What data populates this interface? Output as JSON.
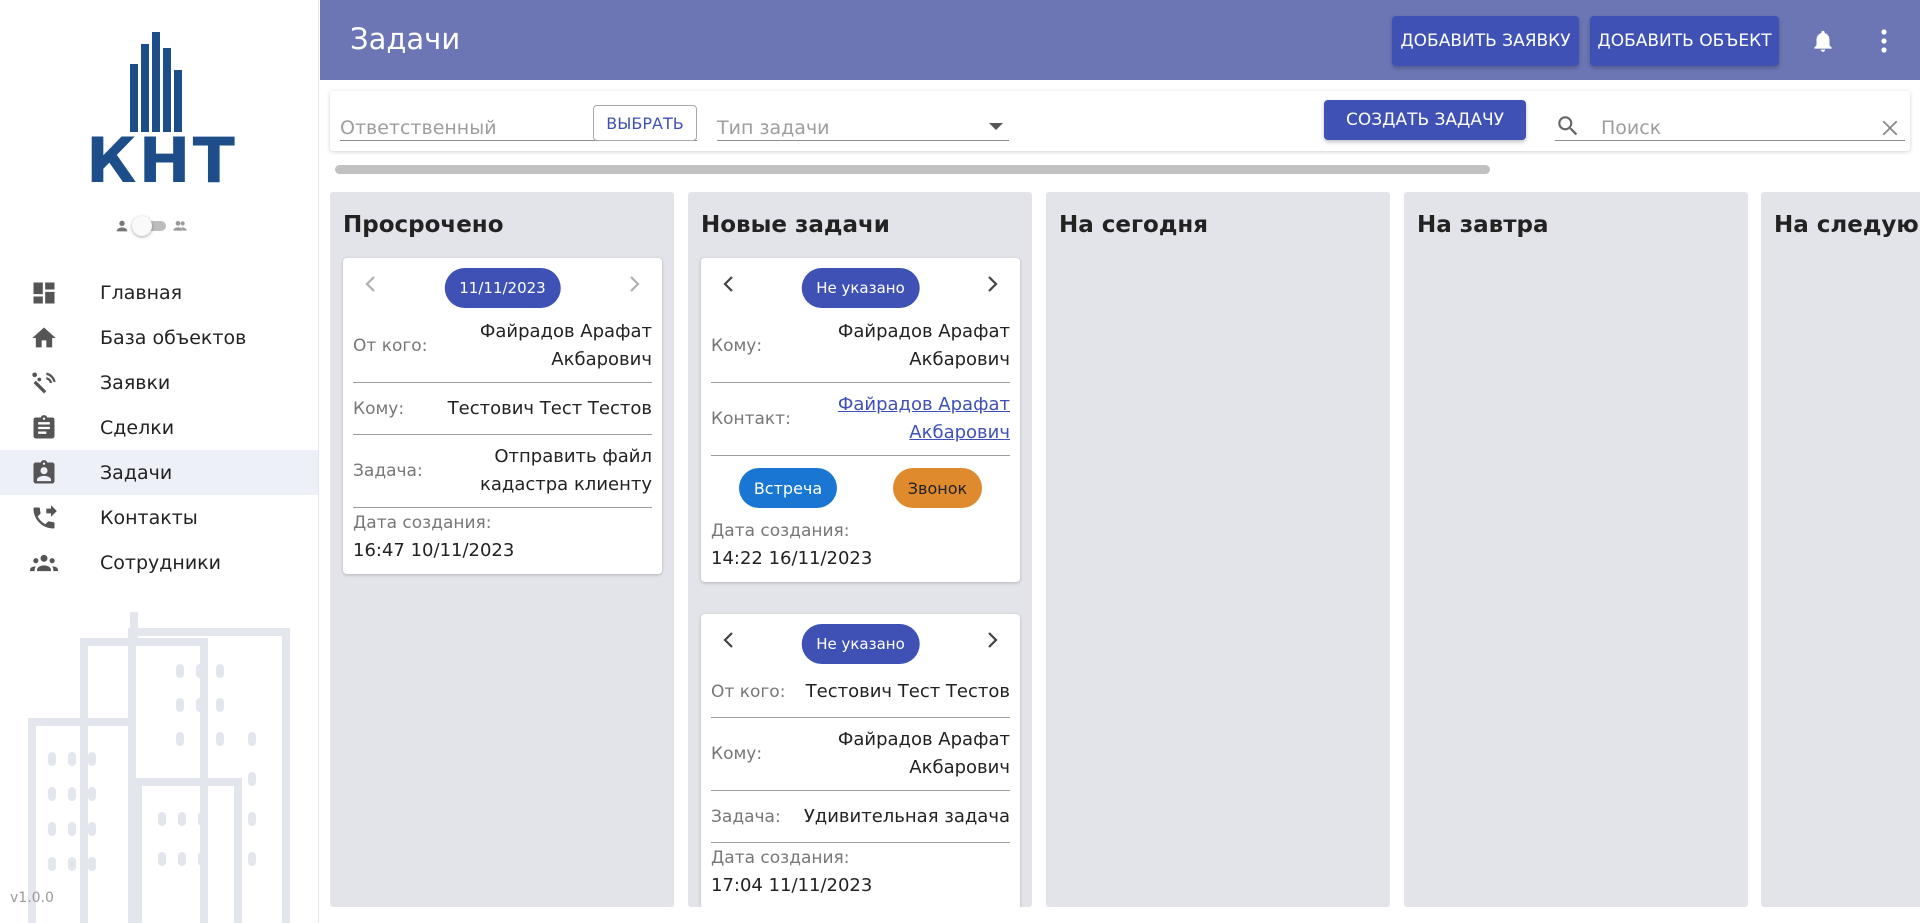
{
  "app": {
    "logo_text": "КНТ",
    "version": "v1.0.0"
  },
  "sidebar": {
    "items": [
      {
        "label": "Главная",
        "icon": "dashboard-icon"
      },
      {
        "label": "База объектов",
        "icon": "home-icon"
      },
      {
        "label": "Заявки",
        "icon": "signal-icon"
      },
      {
        "label": "Сделки",
        "icon": "clipboard-icon"
      },
      {
        "label": "Задачи",
        "icon": "assignment-ind-icon",
        "active": true
      },
      {
        "label": "Контакты",
        "icon": "phone-forwarded-icon"
      },
      {
        "label": "Сотрудники",
        "icon": "group-icon"
      }
    ]
  },
  "header": {
    "title": "Задачи",
    "add_request_label": "ДОБАВИТЬ ЗАЯВКУ",
    "add_object_label": "ДОБАВИТЬ ОБЪЕКТ"
  },
  "filters": {
    "responsible_placeholder": "Ответственный",
    "select_label": "ВЫБРАТЬ",
    "task_type_placeholder": "Тип задачи",
    "create_task_label": "СОЗДАТЬ ЗАДАЧУ",
    "search_placeholder": "Поиск"
  },
  "columns": [
    {
      "title": "Просрочено"
    },
    {
      "title": "Новые задачи"
    },
    {
      "title": "На сегодня"
    },
    {
      "title": "На завтра"
    },
    {
      "title": "На следующ"
    }
  ],
  "cards": {
    "overdue_1": {
      "date": "11/11/2023",
      "from_label": "От кого:",
      "from_value": "Файрадов Арафат Акбарович",
      "to_label": "Кому:",
      "to_value": "Тестович Тест Тестов",
      "task_label": "Задача:",
      "task_value": "Отправить файл кадастра клиенту",
      "created_label": "Дата создания:",
      "created_value": "16:47 10/11/2023"
    },
    "new_1": {
      "date": "Не указано",
      "to_label": "Кому:",
      "to_value": "Файрадов Арафат Акбарович",
      "contact_label": "Контакт:",
      "contact_value": "Файрадов Арафат Акбарович",
      "tag_meet": "Встреча",
      "tag_call": "Звонок",
      "created_label": "Дата создания:",
      "created_value": "14:22 16/11/2023"
    },
    "new_2": {
      "date": "Не указано",
      "from_label": "От кого:",
      "from_value": "Тестович Тест Тестов",
      "to_label": "Кому:",
      "to_value": "Файрадов Арафат Акбарович",
      "task_label": "Задача:",
      "task_value": "Удивительная задача",
      "created_label": "Дата создания:",
      "created_value": "17:04 11/11/2023"
    }
  },
  "colors": {
    "header_bg": "#6c76b5",
    "primary": "#3f51b5",
    "logo": "#1d4e8a",
    "column_bg": "#e3e4e9",
    "tag_meet": "#1976d2",
    "tag_call": "#e08a2e"
  }
}
